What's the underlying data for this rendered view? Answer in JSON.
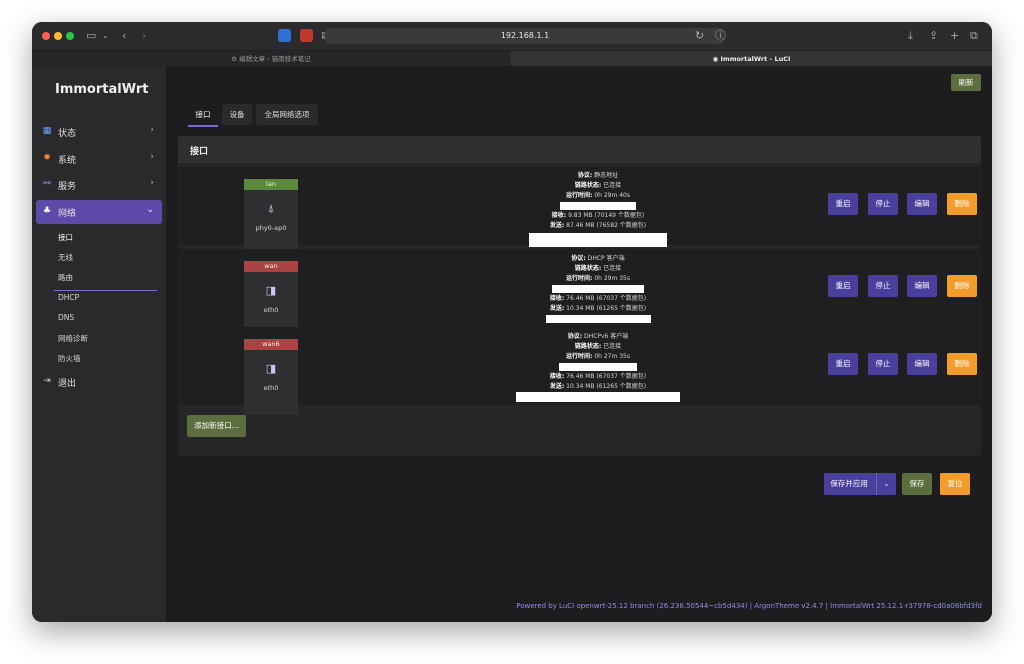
{
  "browser": {
    "url": "192.168.1.1",
    "tabs": [
      {
        "label": "编辑文章 ‹ 猫雨技术笔记"
      },
      {
        "label": "ImmortalWrt - LuCI"
      }
    ]
  },
  "sidebar": {
    "logo": "ImmortalWrt",
    "items": [
      {
        "label": "状态"
      },
      {
        "label": "系统"
      },
      {
        "label": "服务"
      },
      {
        "label": "网络"
      },
      {
        "label": "退出"
      }
    ],
    "network_sub": [
      "接口",
      "无线",
      "路由",
      "DHCP",
      "DNS",
      "网络诊断",
      "防火墙"
    ]
  },
  "header": {
    "refresh_label": "刷新"
  },
  "page_tabs": [
    "接口",
    "设备",
    "全局网络选项"
  ],
  "section_title": "接口",
  "info_labels": {
    "protocol": "协议:",
    "link": "链路状态:",
    "uptime": "运行时间:",
    "rx": "接收:",
    "tx": "发送:"
  },
  "interfaces": [
    {
      "name": "lan",
      "color": "#5b8a3c",
      "device": "phy0-ap0",
      "protocol": "静态地址",
      "link": "已连接",
      "uptime": "0h 29m 40s",
      "rx": "9.83 MB (70149 个数据包)",
      "tx": "87.46 MB (76582 个数据包)"
    },
    {
      "name": "wan",
      "color": "#a94442",
      "device": "eth0",
      "protocol": "DHCP 客户端",
      "link": "已连接",
      "uptime": "0h 29m 35s",
      "rx": "76.46 MB (67037 个数据包)",
      "tx": "10.34 MB (61265 个数据包)"
    },
    {
      "name": "wan6",
      "color": "#a94442",
      "device": "eth0",
      "protocol": "DHCPv6 客户端",
      "link": "已连接",
      "uptime": "0h 27m 35s",
      "rx": "76.46 MB (67037 个数据包)",
      "tx": "10.34 MB (61265 个数据包)"
    }
  ],
  "row_actions": [
    "重启",
    "停止",
    "编辑",
    "删除"
  ],
  "add_interface_label": "添加新接口...",
  "bottom_actions": {
    "save_apply": "保存并应用",
    "save": "保存",
    "reset": "复位"
  },
  "footer": "Powered by LuCI openwrt-25.12 branch (26.236.50544~cb5d434)  |  ArgonTheme v2.4.7  |  ImmortalWrt 25.12.1-r37978-cd0a06bfd3fd",
  "icons": {
    "status": "dashboard-icon",
    "system": "gear-icon",
    "services": "services-icon",
    "network": "network-icon",
    "logout": "logout-icon",
    "wifi": "wifi-icon",
    "ethernet": "ethernet-icon"
  }
}
